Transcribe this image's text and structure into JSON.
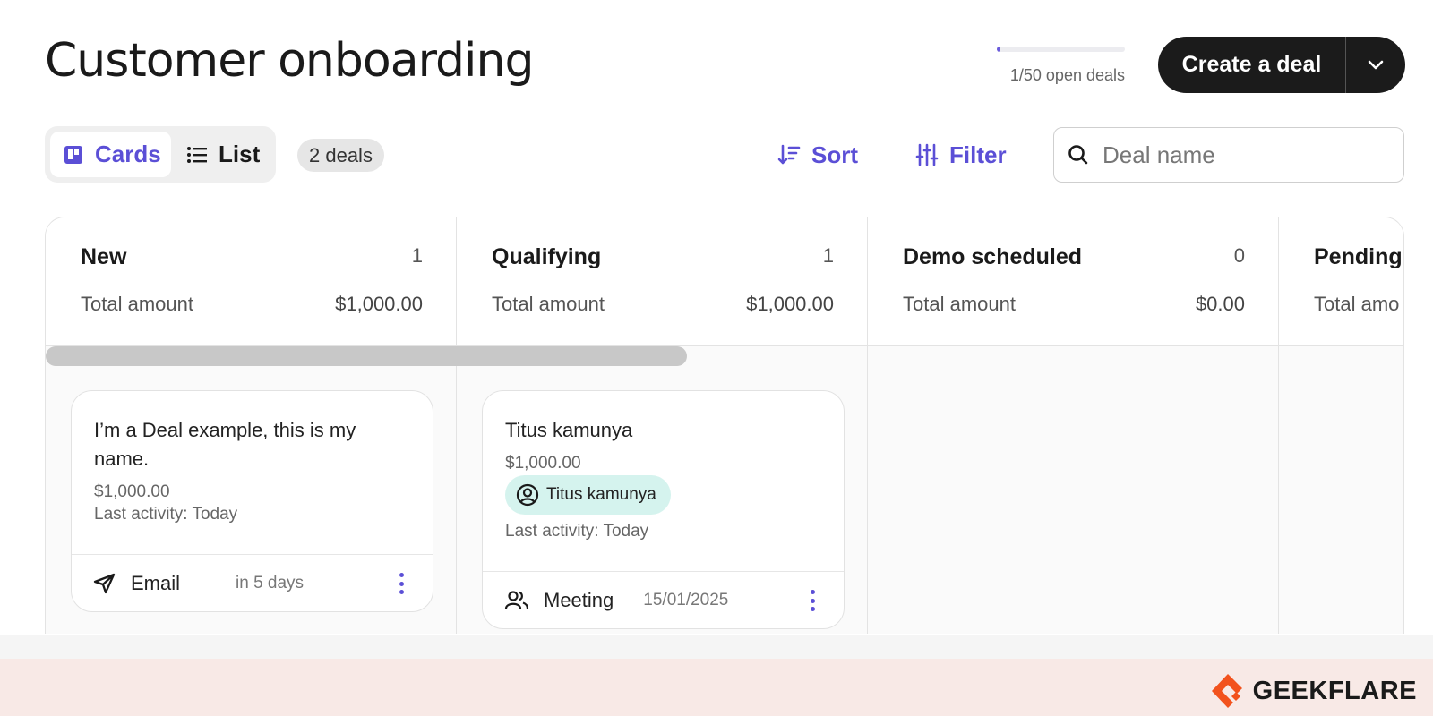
{
  "page": {
    "title": "Customer onboarding"
  },
  "quota": {
    "label": "1/50 open deals",
    "fraction": 0.02
  },
  "create_button": {
    "label": "Create a deal"
  },
  "view_toggle": {
    "cards_label": "Cards",
    "list_label": "List",
    "active": "Cards"
  },
  "deals_badge": "2 deals",
  "toolbar": {
    "sort_label": "Sort",
    "filter_label": "Filter"
  },
  "search": {
    "placeholder": "Deal name",
    "value": ""
  },
  "columns": [
    {
      "name": "New",
      "count": "1",
      "total_label": "Total amount",
      "total_value": "$1,000.00"
    },
    {
      "name": "Qualifying",
      "count": "1",
      "total_label": "Total amount",
      "total_value": "$1,000.00"
    },
    {
      "name": "Demo scheduled",
      "count": "0",
      "total_label": "Total amount",
      "total_value": "$0.00"
    },
    {
      "name": "Pending",
      "count": "",
      "total_label": "Total amo",
      "total_value": ""
    }
  ],
  "cards": [
    {
      "title": "I’m a Deal example, this is my name.",
      "amount": "$1,000.00",
      "activity": "Last activity: Today",
      "task_icon": "send-icon",
      "task_label": "Email",
      "task_when": "in 5 days"
    },
    {
      "title": "Titus kamunya",
      "amount": "$1,000.00",
      "contact": "Titus kamunya",
      "activity": "Last activity: Today",
      "task_icon": "people-icon",
      "task_label": "Meeting",
      "task_when": "15/01/2025"
    }
  ],
  "brand": {
    "name": "GEEKFLARE",
    "accent": "#f2521d"
  },
  "colors": {
    "accent": "#5b4fd6",
    "dark": "#1b1b1b",
    "chip": "#d5f3ee"
  }
}
